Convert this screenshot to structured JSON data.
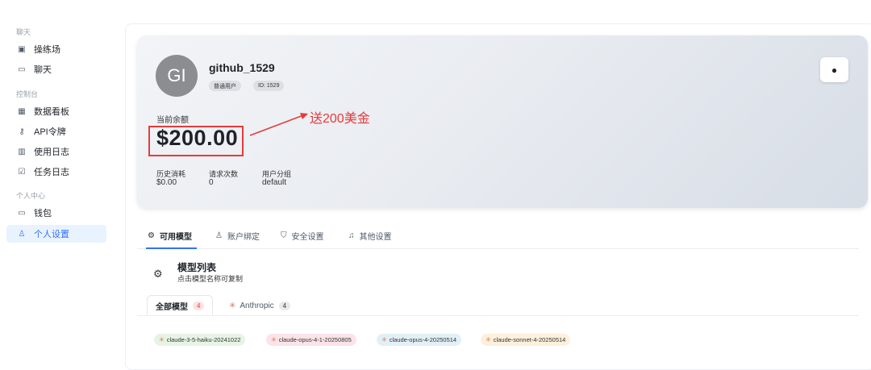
{
  "sidebar": {
    "sections": [
      {
        "label": "聊天"
      },
      {
        "label": "控制台"
      },
      {
        "label": "个人中心"
      }
    ],
    "items": [
      {
        "label": "操练场",
        "icon": "terminal-icon"
      },
      {
        "label": "聊天",
        "icon": "chat-icon"
      },
      {
        "label": "数据看板",
        "icon": "dashboard-icon"
      },
      {
        "label": "API令牌",
        "icon": "key-icon"
      },
      {
        "label": "使用日志",
        "icon": "chart-icon"
      },
      {
        "label": "任务日志",
        "icon": "checklist-icon"
      },
      {
        "label": "钱包",
        "icon": "wallet-icon"
      },
      {
        "label": "个人设置",
        "icon": "user-icon",
        "active": true
      }
    ]
  },
  "profile": {
    "avatar_initials": "GI",
    "username": "github_1529",
    "role_tag": "普通用户",
    "id_tag": "ID: 1529",
    "balance_label": "当前余额",
    "balance": "$200.00",
    "annotation": "送200美金",
    "stats": [
      {
        "label": "历史消耗",
        "value": "$0.00"
      },
      {
        "label": "请求次数",
        "value": "0"
      },
      {
        "label": "用户分组",
        "value": "default"
      }
    ]
  },
  "tabs": [
    {
      "label": "可用模型",
      "icon": "gear-icon",
      "active": true
    },
    {
      "label": "账户绑定",
      "icon": "user-link-icon"
    },
    {
      "label": "安全设置",
      "icon": "shield-icon"
    },
    {
      "label": "其他设置",
      "icon": "bell-icon"
    }
  ],
  "model_list": {
    "title": "模型列表",
    "subtitle": "点击模型名称可复制",
    "filters": [
      {
        "label": "全部模型",
        "count": "4",
        "active": true
      },
      {
        "label": "Anthropic",
        "count": "4"
      }
    ],
    "models": [
      {
        "name": "claude-3-5-haiku-20241022",
        "color": "#e6f4e6"
      },
      {
        "name": "claude-opus-4-1-20250805",
        "color": "#fbe3e8"
      },
      {
        "name": "claude-opus-4-20250514",
        "color": "#e1f0f7"
      },
      {
        "name": "claude-sonnet-4-20250514",
        "color": "#fdf0dc"
      }
    ]
  },
  "colors": {
    "accent": "#3370ff",
    "highlight": "#e63b3b",
    "anthropic_star": "#d97757"
  }
}
